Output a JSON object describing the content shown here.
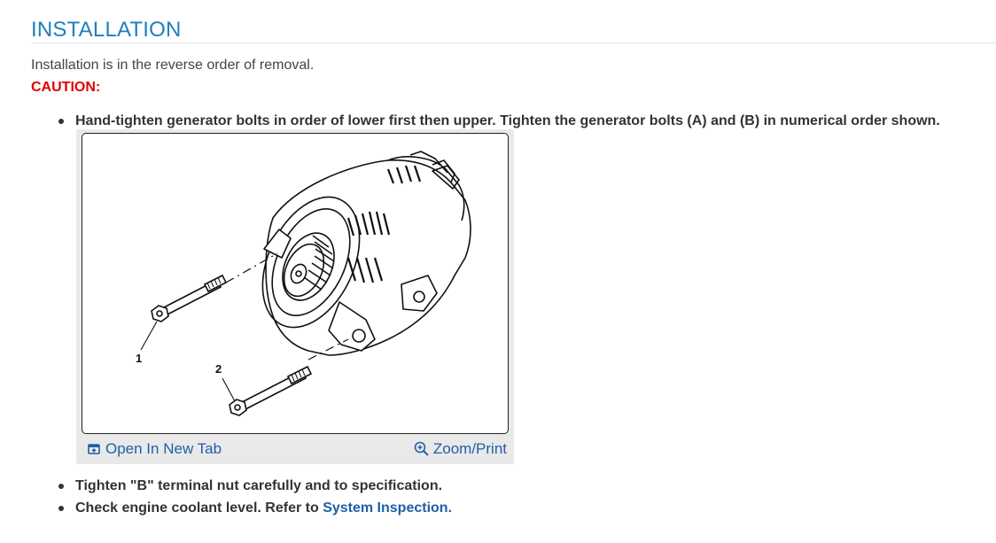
{
  "section": {
    "title": "INSTALLATION"
  },
  "intro": "Installation is in the reverse order of removal.",
  "caution_label": "CAUTION:",
  "bullets": [
    {
      "text": "Hand-tighten generator bolts in order of lower first then upper. Tighten the generator bolts (A) and (B) in numerical order shown."
    },
    {
      "text": "Tighten \"B\" terminal nut carefully and to specification."
    },
    {
      "text": "Check engine coolant level. Refer to ",
      "link": "System Inspection."
    }
  ],
  "figure": {
    "callouts": [
      "1",
      "2"
    ],
    "open_tab_label": "Open In New Tab",
    "zoom_label": "Zoom/Print",
    "open_tab_icon": "open-new-tab-icon",
    "zoom_icon": "zoom-in-icon"
  },
  "colors": {
    "title": "#1f7fbf",
    "caution": "#e00000",
    "link": "#1f5fa8"
  }
}
